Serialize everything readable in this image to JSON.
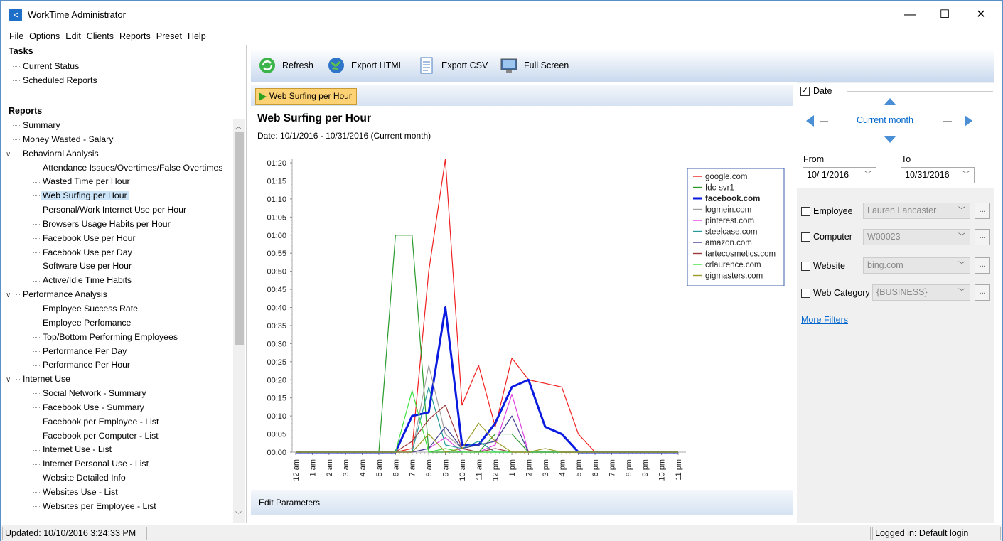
{
  "app": {
    "title": "WorkTime Administrator"
  },
  "menu": [
    "File",
    "Options",
    "Edit",
    "Clients",
    "Reports",
    "Preset",
    "Help"
  ],
  "tasks": {
    "heading": "Tasks",
    "items": [
      "Current Status",
      "Scheduled Reports"
    ]
  },
  "reports": {
    "heading": "Reports",
    "items": [
      {
        "label": "Summary",
        "level": 0
      },
      {
        "label": "Money Wasted - Salary",
        "level": 0
      },
      {
        "label": "Behavioral Analysis",
        "level": 0,
        "expanded": true
      },
      {
        "label": "Attendance Issues/Overtimes/False Overtimes",
        "level": 1
      },
      {
        "label": "Wasted Time per Hour",
        "level": 1
      },
      {
        "label": "Web Surfing per Hour",
        "level": 1,
        "selected": true
      },
      {
        "label": "Personal/Work Internet Use per Hour",
        "level": 1
      },
      {
        "label": "Browsers Usage Habits per Hour",
        "level": 1
      },
      {
        "label": "Facebook Use per Hour",
        "level": 1
      },
      {
        "label": "Facebook Use per Day",
        "level": 1
      },
      {
        "label": "Software Use per Hour",
        "level": 1
      },
      {
        "label": "Active/Idle Time Habits",
        "level": 1
      },
      {
        "label": "Performance Analysis",
        "level": 0,
        "expanded": true
      },
      {
        "label": "Employee Success Rate",
        "level": 1
      },
      {
        "label": "Employee Perfomance",
        "level": 1
      },
      {
        "label": "Top/Bottom Performing Employees",
        "level": 1
      },
      {
        "label": "Performance Per Day",
        "level": 1
      },
      {
        "label": "Performance Per Hour",
        "level": 1
      },
      {
        "label": "Internet Use",
        "level": 0,
        "expanded": true
      },
      {
        "label": "Social Network - Summary",
        "level": 1
      },
      {
        "label": "Facebook Use - Summary",
        "level": 1
      },
      {
        "label": "Facebook per Employee - List",
        "level": 1
      },
      {
        "label": "Facebook per Computer - List",
        "level": 1
      },
      {
        "label": "Internet Use - List",
        "level": 1
      },
      {
        "label": "Internet Personal Use - List",
        "level": 1
      },
      {
        "label": "Website Detailed Info",
        "level": 1
      },
      {
        "label": "Websites Use - List",
        "level": 1
      },
      {
        "label": "Websites per Employee - List",
        "level": 1
      }
    ]
  },
  "toolbar": {
    "refresh": "Refresh",
    "export_html": "Export HTML",
    "export_csv": "Export CSV",
    "full_screen": "Full Screen"
  },
  "report": {
    "tab_label": "Web Surfing per Hour",
    "title": "Web Surfing per Hour",
    "date_line": "Date: 10/1/2016 - 10/31/2016 (Current month)",
    "edit_params": "Edit Parameters"
  },
  "filters": {
    "date_label": "Date",
    "period": "Current month",
    "from_label": "From",
    "to_label": "To",
    "from_value": "10/ 1/2016",
    "to_value": "10/31/2016",
    "employee_label": "Employee",
    "employee_value": "Lauren Lancaster",
    "computer_label": "Computer",
    "computer_value": "W00023",
    "website_label": "Website",
    "website_value": "bing.com",
    "webcat_label": "Web Category",
    "webcat_value": "{BUSINESS}",
    "more_filters": "More Filters",
    "dots": "..."
  },
  "status": {
    "updated": "Updated: 10/10/2016 3:24:33 PM",
    "login": "Logged in: Default login"
  },
  "chart_data": {
    "type": "line",
    "x": [
      "12 am",
      "1 am",
      "2 am",
      "3 am",
      "4 am",
      "5 am",
      "6 am",
      "7 am",
      "8 am",
      "9 am",
      "10 am",
      "11 am",
      "12 pm",
      "1 pm",
      "2 pm",
      "3 pm",
      "4 pm",
      "5 pm",
      "6 pm",
      "7 pm",
      "8 pm",
      "9 pm",
      "10 pm",
      "11 pm"
    ],
    "y_ticks": [
      "00:00",
      "00:05",
      "00:10",
      "00:15",
      "00:20",
      "00:25",
      "00:30",
      "00:35",
      "00:40",
      "00:45",
      "00:50",
      "00:55",
      "01:00",
      "01:05",
      "01:10",
      "01:15",
      "01:20"
    ],
    "ylim": [
      0,
      80
    ],
    "legend_position": "top-right",
    "series": [
      {
        "name": "google.com",
        "color": "#f02020",
        "values": [
          0,
          0,
          0,
          0,
          0,
          0,
          0,
          1,
          50,
          81,
          13,
          24,
          7,
          26,
          20,
          19,
          18,
          5,
          0,
          0,
          0,
          0,
          0,
          0
        ]
      },
      {
        "name": "fdc-svr1",
        "color": "#2a9a2a",
        "values": [
          0,
          0,
          0,
          0,
          0,
          0,
          60,
          60,
          0,
          0,
          0,
          0,
          5,
          5,
          0,
          0,
          0,
          0,
          0,
          0,
          0,
          0,
          0,
          0
        ]
      },
      {
        "name": "facebook.com",
        "color": "#0a1adf",
        "bold": true,
        "values": [
          0,
          0,
          0,
          0,
          0,
          0,
          0,
          10,
          11,
          40,
          2,
          2,
          8,
          18,
          20,
          7,
          5,
          0,
          0,
          0,
          0,
          0,
          0,
          0
        ]
      },
      {
        "name": "logmein.com",
        "color": "#a0a0a0",
        "values": [
          0,
          0,
          0,
          0,
          0,
          0,
          0,
          0,
          24,
          5,
          1,
          0,
          0,
          0,
          0,
          0,
          0,
          0,
          0,
          0,
          0,
          0,
          0,
          0
        ]
      },
      {
        "name": "pinterest.com",
        "color": "#e040e0",
        "values": [
          0,
          0,
          0,
          0,
          0,
          0,
          0,
          0,
          1,
          4,
          0,
          0,
          2,
          16,
          0,
          0,
          0,
          0,
          0,
          0,
          0,
          0,
          0,
          0
        ]
      },
      {
        "name": "steelcase.com",
        "color": "#2a9a9a",
        "values": [
          0,
          0,
          0,
          0,
          0,
          0,
          0,
          0,
          18,
          2,
          1,
          3,
          0,
          0,
          0,
          0,
          0,
          0,
          0,
          0,
          0,
          0,
          0,
          0
        ]
      },
      {
        "name": "amazon.com",
        "color": "#404090",
        "values": [
          0,
          0,
          0,
          0,
          0,
          0,
          0,
          0,
          1,
          7,
          1,
          2,
          3,
          10,
          0,
          0,
          0,
          0,
          0,
          0,
          0,
          0,
          0,
          0
        ]
      },
      {
        "name": "tartecosmetics.com",
        "color": "#9b3a3a",
        "values": [
          0,
          0,
          0,
          0,
          0,
          0,
          0,
          3,
          9,
          13,
          1,
          0,
          1,
          0,
          0,
          0,
          0,
          0,
          0,
          0,
          0,
          0,
          0,
          0
        ]
      },
      {
        "name": "crlaurence.com",
        "color": "#40e040",
        "values": [
          0,
          0,
          0,
          0,
          0,
          0,
          0,
          17,
          0,
          1,
          0,
          0,
          0,
          0,
          0,
          0,
          0,
          0,
          0,
          0,
          0,
          0,
          0,
          0
        ]
      },
      {
        "name": "gigmasters.com",
        "color": "#9a9a2a",
        "values": [
          0,
          0,
          0,
          0,
          0,
          0,
          0,
          0,
          5,
          0,
          1,
          8,
          3,
          0,
          0,
          1,
          0,
          0,
          0,
          0,
          0,
          0,
          0,
          0
        ]
      }
    ]
  }
}
